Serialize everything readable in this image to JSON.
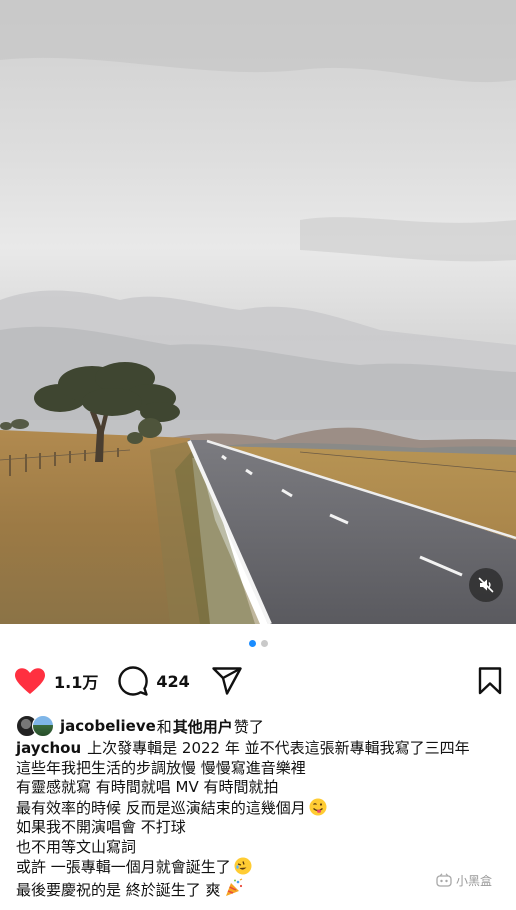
{
  "post": {
    "carousel": {
      "total": 2,
      "active": 1
    },
    "actions": {
      "like_count": "1.1万",
      "comment_count": "424"
    },
    "likes": {
      "username": "jacobelieve",
      "connector": "和",
      "others": "其他用户",
      "suffix": "赞了"
    },
    "caption": {
      "author": "jaychou",
      "lines": [
        "上次發專輯是 2022 年 並不代表這張新專輯我寫了三四年",
        "這些年我把生活的步調放慢 慢慢寫進音樂裡",
        "有靈感就寫 有時間就唱 MV 有時間就拍",
        "最有效率的時候 反而是巡演結束的這幾個月",
        "如果我不開演唱會 不打球",
        "也不用等文山寫詞",
        "或許  一張專輯一個月就會誕生了",
        "最後要慶祝的是 終於誕生了 爽"
      ]
    }
  },
  "icons": {
    "like": "heart-icon",
    "comment": "comment-bubble-icon",
    "share": "paper-plane-icon",
    "save": "bookmark-icon",
    "mute": "speaker-muted-icon",
    "emoji_wink": "winking-face-tongue-emoji",
    "emoji_rofl": "rolling-laughing-emoji",
    "emoji_party": "party-popper-emoji"
  },
  "watermark": {
    "text": "小黑盒"
  },
  "colors": {
    "like_red": "#ff3040",
    "active_dot": "#1a8cff",
    "inactive_dot": "#c9c9c9",
    "text": "#111111"
  }
}
